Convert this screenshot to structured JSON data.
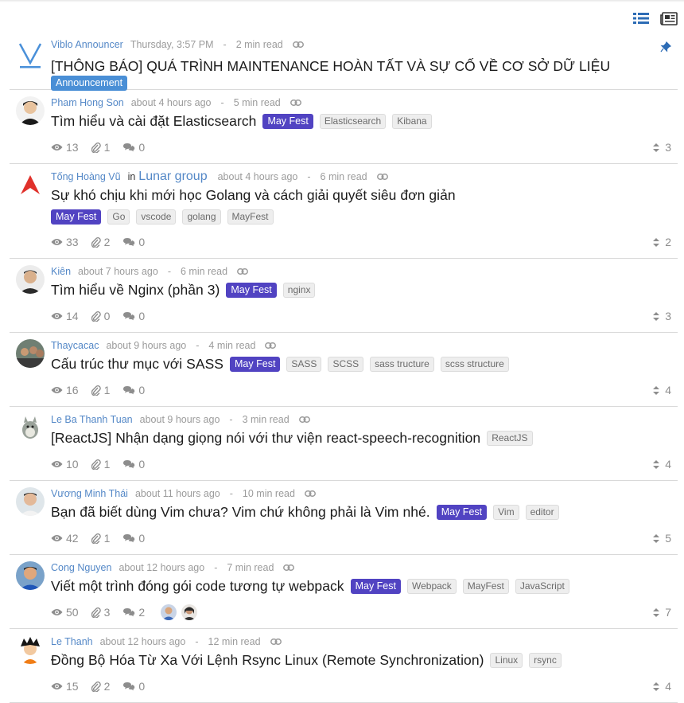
{
  "announcement": {
    "author": "Viblo Announcer",
    "time": "Thursday, 3:57 PM",
    "read_time": "2 min read",
    "title": "[THÔNG BÁO] QUÁ TRÌNH MAINTENANCE HOÀN TẤT VÀ SỰ CỐ VỀ CƠ SỞ DỮ LIỆU",
    "tag": "Announcement"
  },
  "posts": [
    {
      "author": "Pham Hong Son",
      "time": "about 4 hours ago",
      "read_time": "5 min read",
      "title": "Tìm hiểu và cài đặt Elasticsearch",
      "fest": "May Fest",
      "tags": [
        "Elasticsearch",
        "Kibana"
      ],
      "views": "13",
      "clips": "1",
      "comments": "0",
      "score": "3"
    },
    {
      "author": "Tống Hoàng Vũ",
      "in": "in",
      "org": "Lunar group",
      "time": "about 4 hours ago",
      "read_time": "6 min read",
      "title": "Sự khó chịu khi mới học Golang và cách giải quyết siêu đơn giản",
      "fest": "May Fest",
      "tags": [
        "Go",
        "vscode",
        "golang",
        "MayFest"
      ],
      "views": "33",
      "clips": "2",
      "comments": "0",
      "score": "2"
    },
    {
      "author": "Kiên",
      "time": "about 7 hours ago",
      "read_time": "6 min read",
      "title": "Tìm hiểu về Nginx (phần 3)",
      "fest": "May Fest",
      "tags": [
        "nginx"
      ],
      "views": "14",
      "clips": "0",
      "comments": "0",
      "score": "3"
    },
    {
      "author": "Thaycacac",
      "time": "about 9 hours ago",
      "read_time": "4 min read",
      "title": "Cấu trúc thư mục với SASS",
      "fest": "May Fest",
      "tags": [
        "SASS",
        "SCSS",
        "sass tructure",
        "scss structure"
      ],
      "views": "16",
      "clips": "1",
      "comments": "0",
      "score": "4"
    },
    {
      "author": "Le Ba Thanh Tuan",
      "time": "about 9 hours ago",
      "read_time": "3 min read",
      "title": "[ReactJS] Nhận dạng giọng nói với thư viện react-speech-recognition",
      "fest": "",
      "tags": [
        "ReactJS"
      ],
      "views": "10",
      "clips": "1",
      "comments": "0",
      "score": "4"
    },
    {
      "author": "Vương Minh Thái",
      "time": "about 11 hours ago",
      "read_time": "10 min read",
      "title": "Bạn đã biết dùng Vim chưa? Vim chứ không phải là Vim nhé.",
      "fest": "May Fest",
      "tags": [
        "Vim",
        "editor"
      ],
      "views": "42",
      "clips": "1",
      "comments": "0",
      "score": "5"
    },
    {
      "author": "Cong Nguyen",
      "time": "about 12 hours ago",
      "read_time": "7 min read",
      "title": "Viết một trình đóng gói code tương tự webpack",
      "fest": "May Fest",
      "tags": [
        "Webpack",
        "MayFest",
        "JavaScript"
      ],
      "views": "50",
      "clips": "3",
      "comments": "2",
      "score": "7",
      "commenters": true
    },
    {
      "author": "Le Thanh",
      "time": "about 12 hours ago",
      "read_time": "12 min read",
      "title": "Đồng Bộ Hóa Từ Xa Với Lệnh Rsync Linux (Remote Synchronization)",
      "fest": "",
      "tags": [
        "Linux",
        "rsync"
      ],
      "views": "15",
      "clips": "2",
      "comments": "0",
      "score": "4"
    }
  ],
  "icons": {
    "list_view": "list-view-icon",
    "card_view": "newspaper-icon",
    "pin": "pin-icon",
    "views": "eye-icon",
    "clips": "paperclip-icon",
    "comments": "comments-icon",
    "score": "updown-icon",
    "link": "chain-link-icon"
  },
  "colors": {
    "author": "#5488c7",
    "may_fest": "#5143c2",
    "announcement": "#4a8fd6",
    "muted": "#9b9b9b"
  }
}
